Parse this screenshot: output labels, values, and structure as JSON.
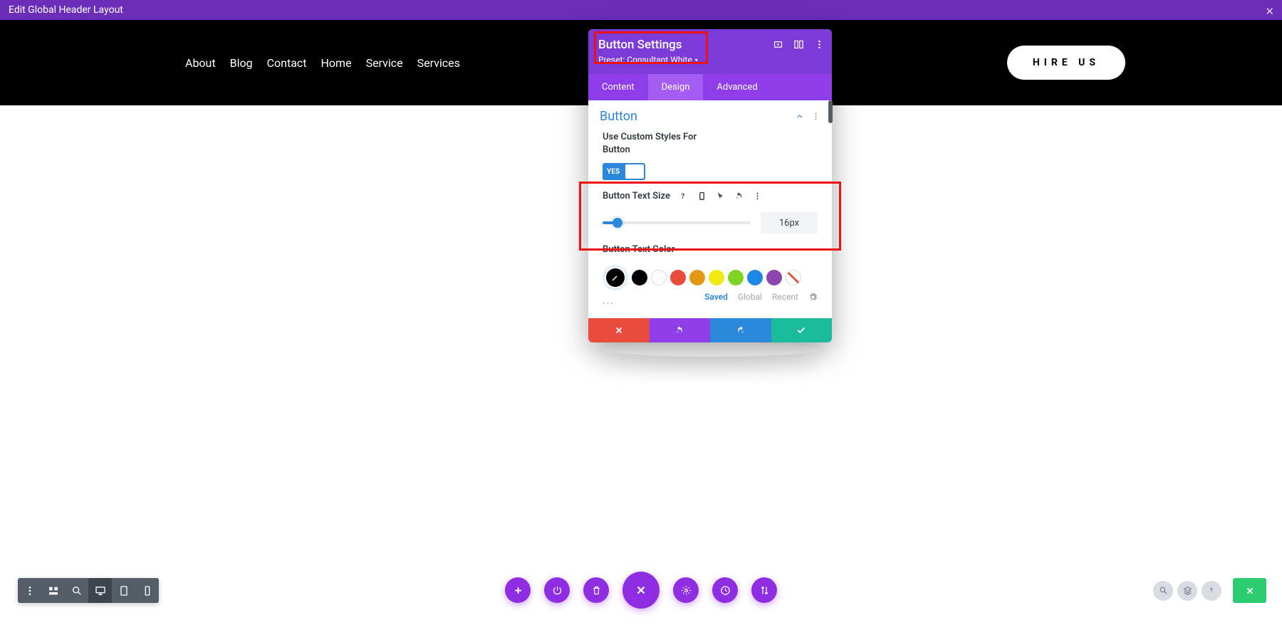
{
  "topbar": {
    "title": "Edit Global Header Layout"
  },
  "nav": {
    "items": [
      "About",
      "Blog",
      "Contact",
      "Home",
      "Service",
      "Services"
    ],
    "cta": "HIRE US"
  },
  "panel": {
    "title": "Button Settings",
    "preset": "Preset: Consultant White",
    "tabs": [
      "Content",
      "Design",
      "Advanced"
    ],
    "active_tab": 1,
    "section": "Button",
    "custom_styles_label": "Use Custom Styles For Button",
    "toggle_yes": "YES",
    "text_size_label": "Button Text Size",
    "text_size_value": "16px",
    "text_color_label": "Button Text Color",
    "swatches": [
      "#000000",
      "#ffffff",
      "#e74c3c",
      "#e67e22",
      "#f1c40f",
      "#7ed321",
      "#1e88e5",
      "#8e44ad"
    ],
    "color_tabs": [
      "Saved",
      "Global",
      "Recent"
    ]
  }
}
